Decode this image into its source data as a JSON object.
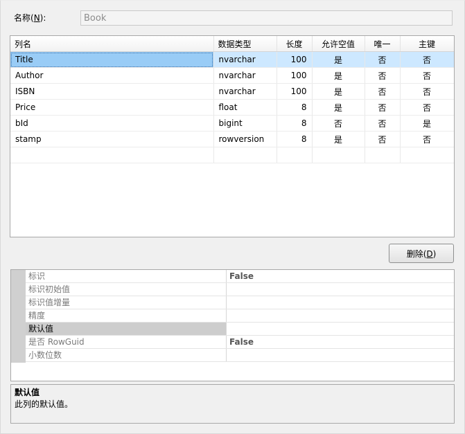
{
  "name_field": {
    "label_text": "名称(",
    "label_mnemonic": "N",
    "label_suffix": "):",
    "value": "Book"
  },
  "columns_grid": {
    "headers": [
      "列名",
      "数据类型",
      "长度",
      "允许空值",
      "唯一",
      "主键"
    ],
    "rows": [
      {
        "name": "Title",
        "type": "nvarchar",
        "length": "100",
        "nullable": "是",
        "unique": "否",
        "primary": "否"
      },
      {
        "name": "Author",
        "type": "nvarchar",
        "length": "100",
        "nullable": "是",
        "unique": "否",
        "primary": "否"
      },
      {
        "name": "ISBN",
        "type": "nvarchar",
        "length": "100",
        "nullable": "是",
        "unique": "否",
        "primary": "否"
      },
      {
        "name": "Price",
        "type": "float",
        "length": "8",
        "nullable": "是",
        "unique": "否",
        "primary": "否"
      },
      {
        "name": "bId",
        "type": "bigint",
        "length": "8",
        "nullable": "否",
        "unique": "否",
        "primary": "是"
      },
      {
        "name": "stamp",
        "type": "rowversion",
        "length": "8",
        "nullable": "是",
        "unique": "否",
        "primary": "否"
      }
    ]
  },
  "delete_button": {
    "label_text": "删除(",
    "label_mnemonic": "D",
    "label_suffix": ")"
  },
  "properties": [
    {
      "name": "标识",
      "value": "False"
    },
    {
      "name": "标识初始值",
      "value": ""
    },
    {
      "name": "标识值增量",
      "value": ""
    },
    {
      "name": "精度",
      "value": ""
    },
    {
      "name": "默认值",
      "value": ""
    },
    {
      "name": "是否 RowGuid",
      "value": "False"
    },
    {
      "name": "小数位数",
      "value": ""
    }
  ],
  "description": {
    "title": "默认值",
    "text": "此列的默认值。"
  },
  "colors": {
    "selected_row": "#cde8ff",
    "selected_cell": "#99ccf6",
    "window_bg": "#f0f0f0"
  }
}
